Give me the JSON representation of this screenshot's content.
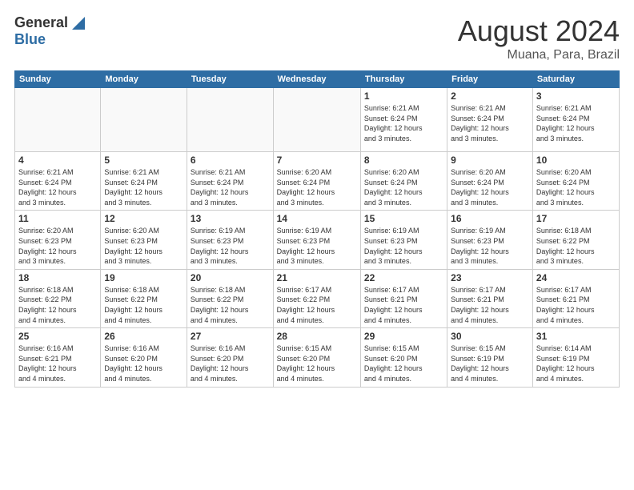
{
  "header": {
    "logo_general": "General",
    "logo_blue": "Blue",
    "title": "August 2024",
    "subtitle": "Muana, Para, Brazil"
  },
  "days_of_week": [
    "Sunday",
    "Monday",
    "Tuesday",
    "Wednesday",
    "Thursday",
    "Friday",
    "Saturday"
  ],
  "weeks": [
    [
      {
        "day": "",
        "info": ""
      },
      {
        "day": "",
        "info": ""
      },
      {
        "day": "",
        "info": ""
      },
      {
        "day": "",
        "info": ""
      },
      {
        "day": "1",
        "info": "Sunrise: 6:21 AM\nSunset: 6:24 PM\nDaylight: 12 hours\nand 3 minutes."
      },
      {
        "day": "2",
        "info": "Sunrise: 6:21 AM\nSunset: 6:24 PM\nDaylight: 12 hours\nand 3 minutes."
      },
      {
        "day": "3",
        "info": "Sunrise: 6:21 AM\nSunset: 6:24 PM\nDaylight: 12 hours\nand 3 minutes."
      }
    ],
    [
      {
        "day": "4",
        "info": "Sunrise: 6:21 AM\nSunset: 6:24 PM\nDaylight: 12 hours\nand 3 minutes."
      },
      {
        "day": "5",
        "info": "Sunrise: 6:21 AM\nSunset: 6:24 PM\nDaylight: 12 hours\nand 3 minutes."
      },
      {
        "day": "6",
        "info": "Sunrise: 6:21 AM\nSunset: 6:24 PM\nDaylight: 12 hours\nand 3 minutes."
      },
      {
        "day": "7",
        "info": "Sunrise: 6:20 AM\nSunset: 6:24 PM\nDaylight: 12 hours\nand 3 minutes."
      },
      {
        "day": "8",
        "info": "Sunrise: 6:20 AM\nSunset: 6:24 PM\nDaylight: 12 hours\nand 3 minutes."
      },
      {
        "day": "9",
        "info": "Sunrise: 6:20 AM\nSunset: 6:24 PM\nDaylight: 12 hours\nand 3 minutes."
      },
      {
        "day": "10",
        "info": "Sunrise: 6:20 AM\nSunset: 6:24 PM\nDaylight: 12 hours\nand 3 minutes."
      }
    ],
    [
      {
        "day": "11",
        "info": "Sunrise: 6:20 AM\nSunset: 6:23 PM\nDaylight: 12 hours\nand 3 minutes."
      },
      {
        "day": "12",
        "info": "Sunrise: 6:20 AM\nSunset: 6:23 PM\nDaylight: 12 hours\nand 3 minutes."
      },
      {
        "day": "13",
        "info": "Sunrise: 6:19 AM\nSunset: 6:23 PM\nDaylight: 12 hours\nand 3 minutes."
      },
      {
        "day": "14",
        "info": "Sunrise: 6:19 AM\nSunset: 6:23 PM\nDaylight: 12 hours\nand 3 minutes."
      },
      {
        "day": "15",
        "info": "Sunrise: 6:19 AM\nSunset: 6:23 PM\nDaylight: 12 hours\nand 3 minutes."
      },
      {
        "day": "16",
        "info": "Sunrise: 6:19 AM\nSunset: 6:23 PM\nDaylight: 12 hours\nand 3 minutes."
      },
      {
        "day": "17",
        "info": "Sunrise: 6:18 AM\nSunset: 6:22 PM\nDaylight: 12 hours\nand 3 minutes."
      }
    ],
    [
      {
        "day": "18",
        "info": "Sunrise: 6:18 AM\nSunset: 6:22 PM\nDaylight: 12 hours\nand 4 minutes."
      },
      {
        "day": "19",
        "info": "Sunrise: 6:18 AM\nSunset: 6:22 PM\nDaylight: 12 hours\nand 4 minutes."
      },
      {
        "day": "20",
        "info": "Sunrise: 6:18 AM\nSunset: 6:22 PM\nDaylight: 12 hours\nand 4 minutes."
      },
      {
        "day": "21",
        "info": "Sunrise: 6:17 AM\nSunset: 6:22 PM\nDaylight: 12 hours\nand 4 minutes."
      },
      {
        "day": "22",
        "info": "Sunrise: 6:17 AM\nSunset: 6:21 PM\nDaylight: 12 hours\nand 4 minutes."
      },
      {
        "day": "23",
        "info": "Sunrise: 6:17 AM\nSunset: 6:21 PM\nDaylight: 12 hours\nand 4 minutes."
      },
      {
        "day": "24",
        "info": "Sunrise: 6:17 AM\nSunset: 6:21 PM\nDaylight: 12 hours\nand 4 minutes."
      }
    ],
    [
      {
        "day": "25",
        "info": "Sunrise: 6:16 AM\nSunset: 6:21 PM\nDaylight: 12 hours\nand 4 minutes."
      },
      {
        "day": "26",
        "info": "Sunrise: 6:16 AM\nSunset: 6:20 PM\nDaylight: 12 hours\nand 4 minutes."
      },
      {
        "day": "27",
        "info": "Sunrise: 6:16 AM\nSunset: 6:20 PM\nDaylight: 12 hours\nand 4 minutes."
      },
      {
        "day": "28",
        "info": "Sunrise: 6:15 AM\nSunset: 6:20 PM\nDaylight: 12 hours\nand 4 minutes."
      },
      {
        "day": "29",
        "info": "Sunrise: 6:15 AM\nSunset: 6:20 PM\nDaylight: 12 hours\nand 4 minutes."
      },
      {
        "day": "30",
        "info": "Sunrise: 6:15 AM\nSunset: 6:19 PM\nDaylight: 12 hours\nand 4 minutes."
      },
      {
        "day": "31",
        "info": "Sunrise: 6:14 AM\nSunset: 6:19 PM\nDaylight: 12 hours\nand 4 minutes."
      }
    ]
  ]
}
